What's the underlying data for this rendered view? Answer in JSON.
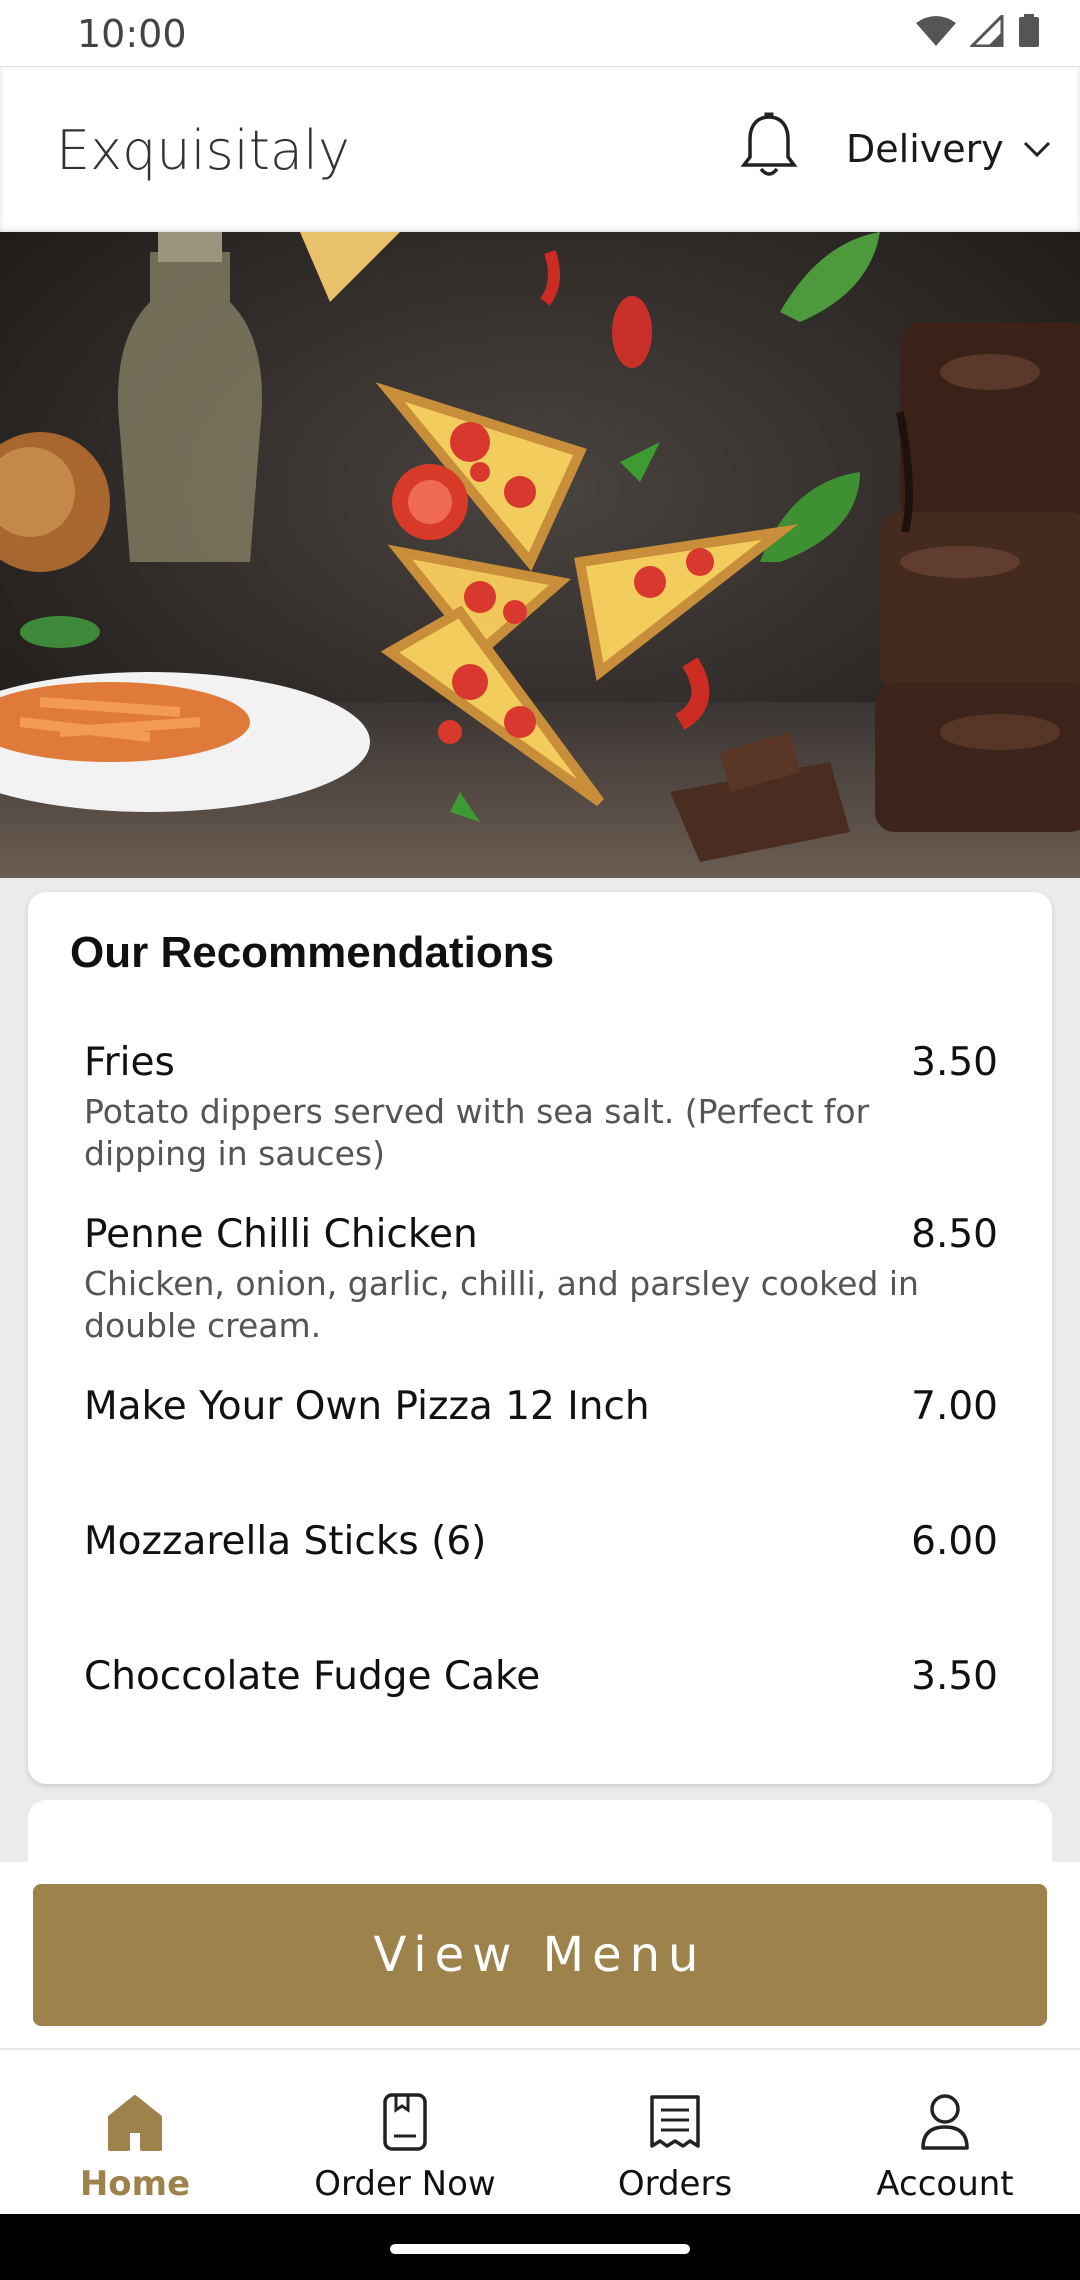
{
  "status_bar": {
    "time": "10:00"
  },
  "header": {
    "title": "Exquisitaly",
    "delivery_label": "Delivery"
  },
  "recommendations": {
    "title": "Our Recommendations",
    "items": [
      {
        "name": "Fries",
        "price": "3.50",
        "description": "Potato dippers served with sea salt. (Perfect for dipping in sauces)"
      },
      {
        "name": "Penne Chilli Chicken",
        "price": "8.50",
        "description": "Chicken, onion, garlic, chilli, and parsley cooked in double cream."
      },
      {
        "name": "Make Your Own Pizza 12 Inch",
        "price": "7.00",
        "description": ""
      },
      {
        "name": "Mozzarella Sticks (6)",
        "price": "6.00",
        "description": ""
      },
      {
        "name": "Choccolate Fudge Cake",
        "price": "3.50",
        "description": ""
      }
    ]
  },
  "view_menu_label": "View Menu",
  "nav": [
    {
      "label": "Home",
      "icon": "home-icon",
      "active": true
    },
    {
      "label": "Order Now",
      "icon": "order-icon",
      "active": false
    },
    {
      "label": "Orders",
      "icon": "receipt-icon",
      "active": false
    },
    {
      "label": "Account",
      "icon": "person-icon",
      "active": false
    }
  ],
  "colors": {
    "accent": "#9e824c",
    "background": "#ebebeb"
  }
}
